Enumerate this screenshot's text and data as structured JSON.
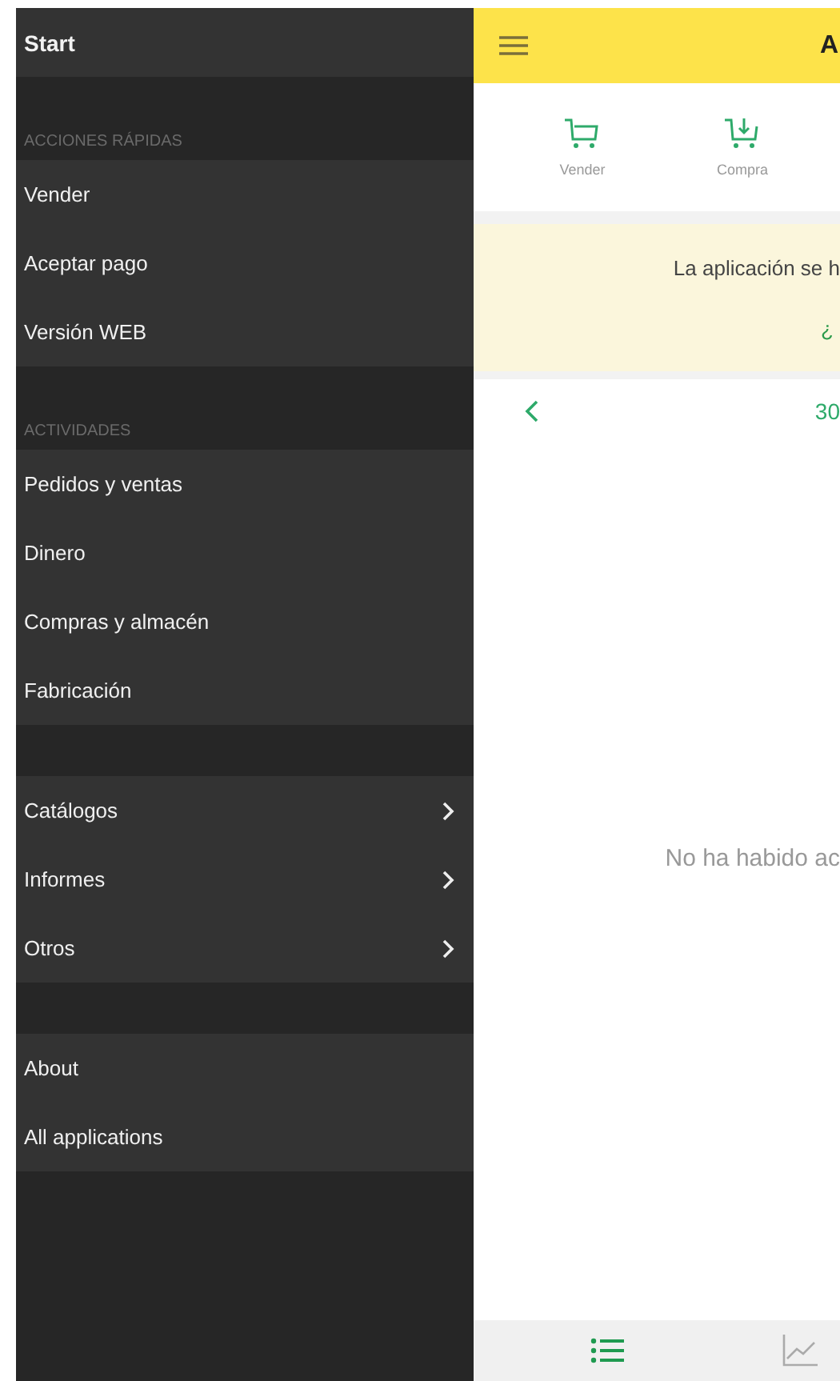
{
  "drawer": {
    "title": "Start",
    "groups": [
      {
        "label": "ACCIONES RÁPIDAS",
        "items": [
          {
            "label": "Vender",
            "submenu": false
          },
          {
            "label": "Aceptar pago",
            "submenu": false
          },
          {
            "label": "Versión WEB",
            "submenu": false
          }
        ]
      },
      {
        "label": "ACTIVIDADES",
        "items": [
          {
            "label": "Pedidos y ventas",
            "submenu": false
          },
          {
            "label": "Dinero",
            "submenu": false
          },
          {
            "label": "Compras y almacén",
            "submenu": false
          },
          {
            "label": "Fabricación",
            "submenu": false
          }
        ]
      },
      {
        "items": [
          {
            "label": "Catálogos",
            "submenu": true
          },
          {
            "label": "Informes",
            "submenu": true
          },
          {
            "label": "Otros",
            "submenu": true
          }
        ]
      },
      {
        "items": [
          {
            "label": "About",
            "submenu": false
          },
          {
            "label": "All applications",
            "submenu": false
          }
        ]
      }
    ]
  },
  "header": {
    "title": "A"
  },
  "quick_actions": [
    {
      "label": "Vender",
      "kind": "sell"
    },
    {
      "label": "Compra",
      "kind": "buy"
    }
  ],
  "banner": {
    "message": "La aplicación se h",
    "link": "¿"
  },
  "date_bar": {
    "date": "30"
  },
  "empty_message": "No ha habido ac",
  "bottom_tabs": [
    {
      "kind": "list",
      "selected": true
    },
    {
      "kind": "chart",
      "selected": false
    }
  ]
}
